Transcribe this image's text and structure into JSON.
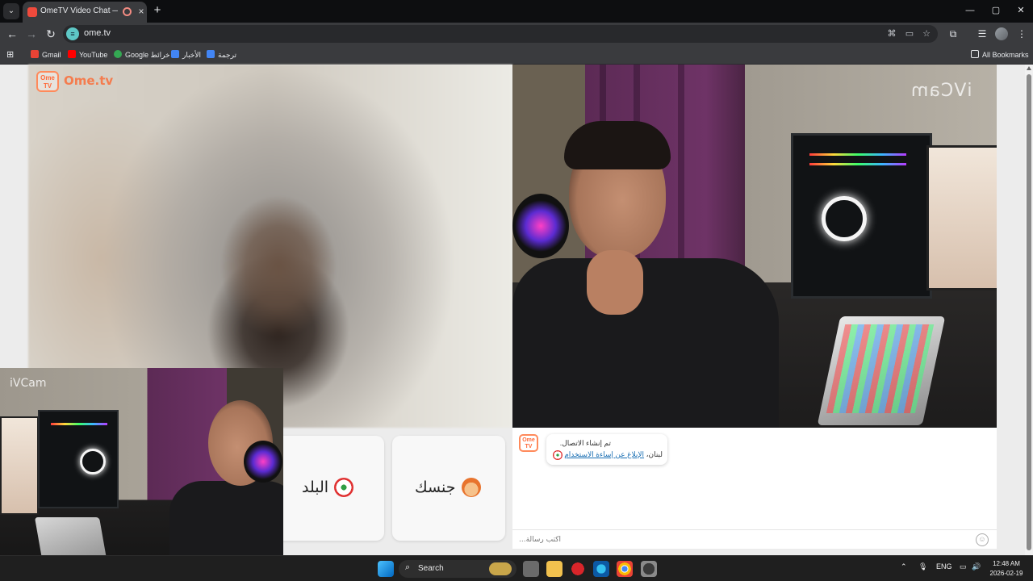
{
  "browser": {
    "tab": {
      "title": "OmeTV Video Chat — Omegle",
      "close": "×"
    },
    "new_tab": "+",
    "window": {
      "minimize": "—",
      "maximize": "▢",
      "close": "✕"
    },
    "nav": {
      "back": "←",
      "forward": "→",
      "reload": "↻"
    },
    "omnibox": {
      "url": "ome.tv"
    },
    "bookmarks": [
      {
        "label": "Gmail",
        "color": "#ea4335"
      },
      {
        "label": "YouTube",
        "color": "#ff0000"
      },
      {
        "label": "Google خرائط",
        "color": "#34a853"
      },
      {
        "label": "الأخبار",
        "color": "#4285f4"
      },
      {
        "label": "ترجمة",
        "color": "#4285f4"
      }
    ],
    "all_bookmarks": "All Bookmarks"
  },
  "page": {
    "logo": {
      "badge": "Ome TV",
      "text": "Ome.tv"
    },
    "my_video_watermark": "iVCam",
    "self_view_watermark": "iVCam",
    "filters": [
      {
        "label": "البلد",
        "emoji": "lebanon-flag"
      },
      {
        "label": "جنسك",
        "emoji": "person-emoji"
      }
    ],
    "chat": {
      "logo_badge": "Ome TV",
      "system_line1": "تم إنشاء الاتصال.",
      "system_line2_prefix": "لبنان،",
      "report_link": "الإبلاغ عن إساءة الاستخدام",
      "input_placeholder": "اكتب رسالة..."
    }
  },
  "taskbar": {
    "search_label": "Search",
    "lang": "ENG",
    "time": "12:48 AM",
    "date": "2026-02-19"
  }
}
